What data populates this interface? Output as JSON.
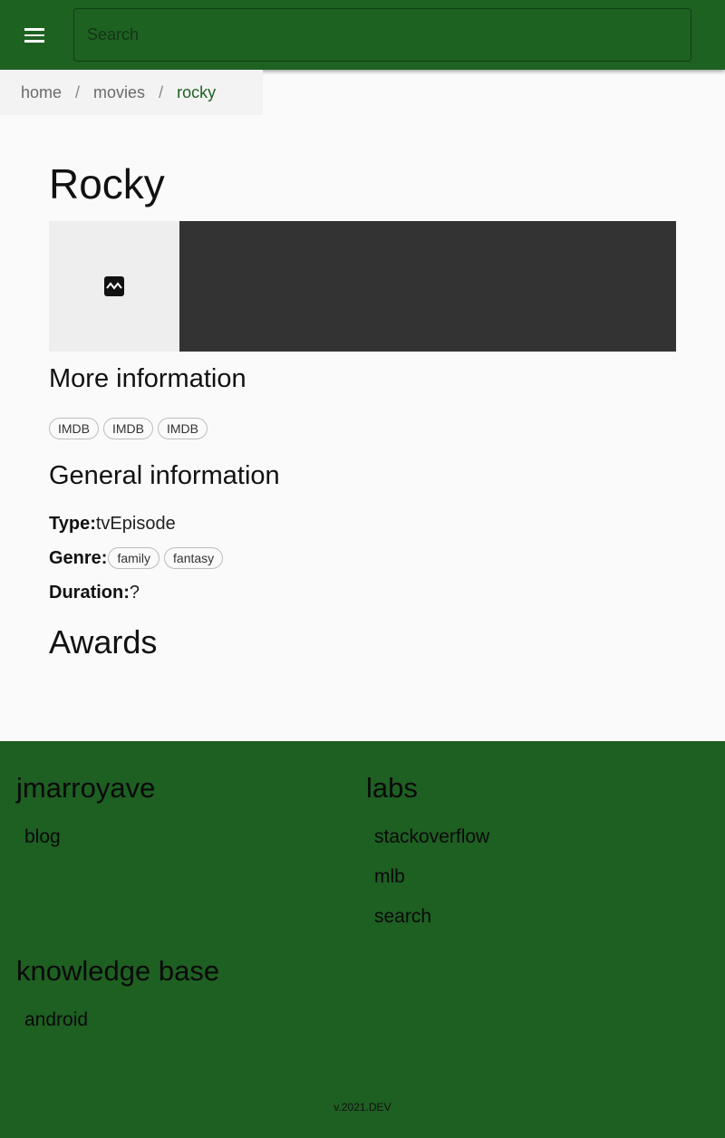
{
  "header": {
    "search_placeholder": "Search",
    "menu_icon": "hamburger-menu-icon"
  },
  "breadcrumb": {
    "items": [
      "home",
      "movies",
      "rocky"
    ],
    "separator": "/"
  },
  "movie": {
    "title": "Rocky",
    "more_info_heading": "More information",
    "links": [
      "IMDB",
      "IMDB",
      "IMDB"
    ],
    "general_heading": "General information",
    "type_label": "Type:",
    "type_value": "tvEpisode",
    "genre_label": "Genre:",
    "genres": [
      "family",
      "fantasy"
    ],
    "duration_label": "Duration:",
    "duration_value": "?",
    "awards_heading": "Awards",
    "image_icon": "broken-image-icon"
  },
  "footer": {
    "sections": [
      {
        "title": "jmarroyave",
        "links": [
          "blog"
        ]
      },
      {
        "title": "labs",
        "links": [
          "stackoverflow",
          "mlb",
          "search"
        ]
      },
      {
        "title": "knowledge base",
        "links": [
          "android"
        ]
      }
    ],
    "version": "v.2021.DEV"
  },
  "colors": {
    "header_green": "#1e6222",
    "footer_green": "#1e5f22",
    "breadcrumb_active": "#1e6222",
    "media_dark": "#333333"
  }
}
